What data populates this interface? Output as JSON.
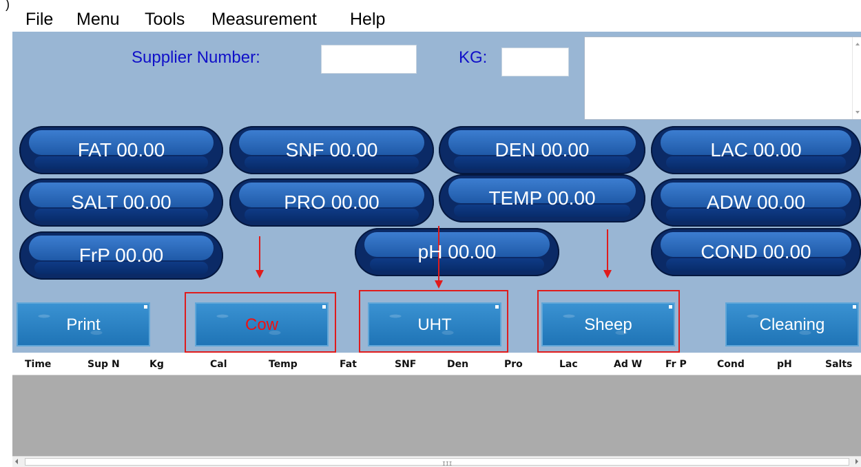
{
  "menu": [
    "File",
    "Menu",
    "Tools",
    "Measurement",
    "Help"
  ],
  "corner_glyph": ")",
  "form": {
    "supplier_label": "Supplier Number:",
    "supplier_value": "",
    "kg_label": "KG:",
    "kg_value": "",
    "notes_value": ""
  },
  "readouts": [
    "FAT 00.00",
    "SNF 00.00",
    "DEN 00.00",
    "LAC 00.00",
    "SALT 00.00",
    "PRO 00.00",
    "TEMP 00.00",
    "ADW 00.00",
    "FrP 00.00",
    "pH 00.00",
    "COND 00.00"
  ],
  "buttons": {
    "print": "Print",
    "cow": "Cow",
    "uht": "UHT",
    "sheep": "Sheep",
    "cleaning": "Cleaning"
  },
  "grid": {
    "columns": [
      "Time",
      "Sup N",
      "Kg",
      "Cal",
      "Temp",
      "Fat",
      "SNF",
      "Den",
      "Pro",
      "Lac",
      "Ad W",
      "Fr P",
      "Cond",
      "pH",
      "Salts"
    ],
    "scroll_grip": "III"
  },
  "colors": {
    "panel": "#99b6d4",
    "label_blue": "#1010c8",
    "pill_dark": "#0b2a66",
    "button_blue": "#2e86c9",
    "highlight_red": "#e01b1b",
    "grid_gray": "#ababab"
  }
}
